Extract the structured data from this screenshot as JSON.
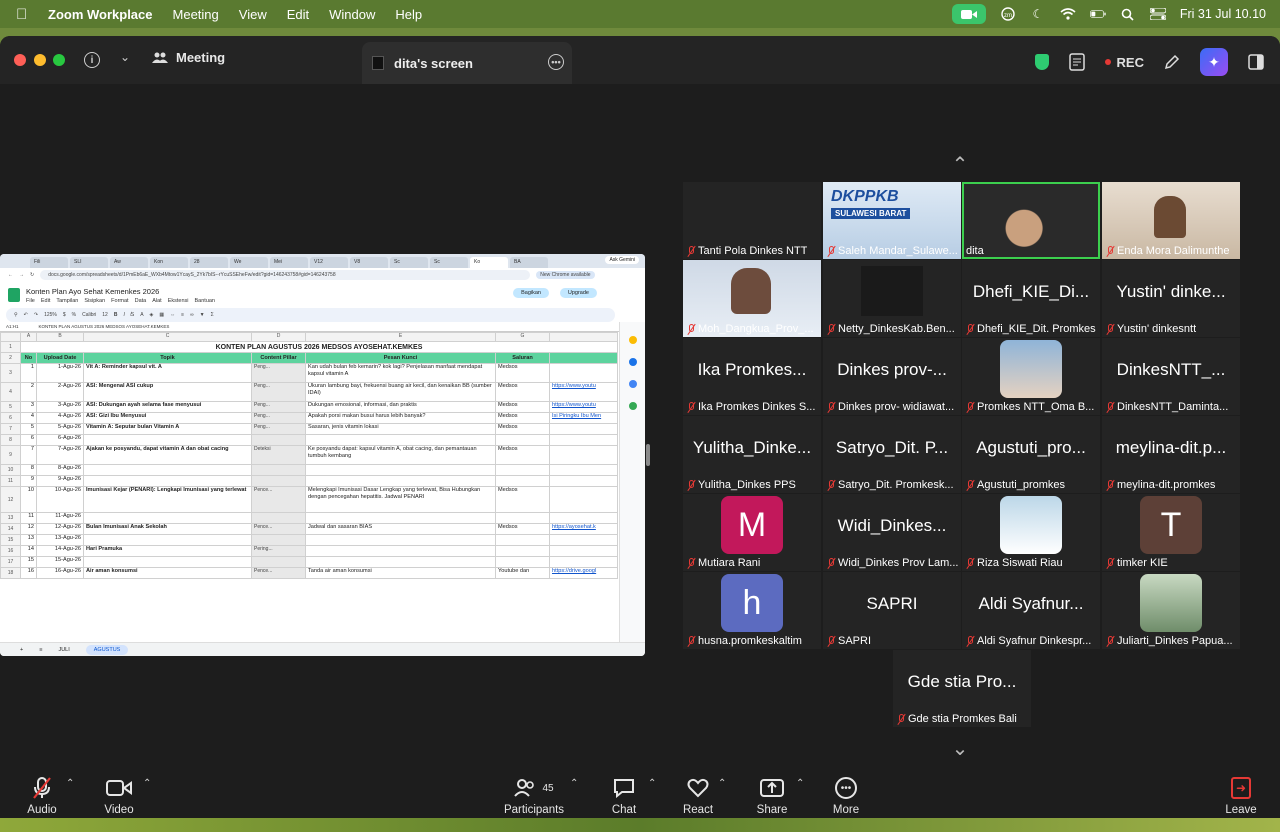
{
  "menubar": {
    "app": "Zoom Workplace",
    "items": [
      "Meeting",
      "View",
      "Edit",
      "Window",
      "Help"
    ],
    "datetime": "Fri 31 Jul  10.10"
  },
  "titlebar": {
    "meeting_label": "Meeting",
    "share_tab": "dita's screen",
    "rec_label": "REC"
  },
  "shared_screen": {
    "browser_tabs": [
      "Fili",
      "SLI",
      "Aw",
      "Kon",
      "28",
      "We",
      "Mei",
      "V12",
      "V8",
      "Sc",
      "Sc",
      "Ko",
      "BA"
    ],
    "ask_gemini": "Ask Gemini",
    "url": "docs.google.com/spreadsheets/d/1PmEb6aE_WXb4Mtow1YcayS_2Yk7bIS--rYcuSSEheFw/edit?gid=146243758#gid=146243758",
    "chrome_available": "New Chrome available",
    "doc_title": "Konten Plan Ayo Sehat Kemenkes 2026",
    "menus": [
      "File",
      "Edit",
      "Tampilan",
      "Sisipkan",
      "Format",
      "Data",
      "Alat",
      "Ekstensi",
      "Bantuan"
    ],
    "share_button": "Bagikan",
    "upgrade_button": "Upgrade",
    "zoom": "125%",
    "font": "Calibri",
    "font_size": "12",
    "cell_ref": "A1:H1",
    "formula": "KONTEN PLAN AGUSTUS 2026 MEDSOS AYOSEHAT.KEMKES",
    "col_letters": [
      "A",
      "B",
      "C",
      "D",
      "E",
      "G"
    ],
    "sheet_title": "KONTEN PLAN AGUSTUS 2026 MEDSOS AYOSEHAT.KEMKES",
    "headers": {
      "no": "No",
      "date": "Upload Date",
      "topic": "Topik",
      "pillar": "Content Pillar",
      "message": "Pesan Kunci",
      "channel": "Saluran"
    },
    "rows": [
      {
        "rn": "3",
        "no": "1",
        "date": "1-Agu-26",
        "topic": "Vit A: Reminder kapsul vit. A",
        "pillar": "Peng...",
        "msg": "Kan udah bulan feb kemarin? kok lagi? Penjelasan manfaat mendapat kapsul vitamin A",
        "ch": "Medsos",
        "link": ""
      },
      {
        "rn": "4",
        "no": "2",
        "date": "2-Agu-26",
        "topic": "ASI: Mengenal ASI cukup",
        "pillar": "Peng...",
        "msg": "Ukuran lambung bayi, frekuensi buang air kecil, dan kenaikan BB (sumber IDAI)",
        "ch": "Medsos",
        "link": "https://www.youtu"
      },
      {
        "rn": "5",
        "no": "3",
        "date": "3-Agu-26",
        "topic": "ASI: Dukungan ayah selama fase menyusui",
        "pillar": "Peng...",
        "msg": "Dukungan emosional, informasi, dan praktis",
        "ch": "Medsos",
        "link": "https://www.youtu"
      },
      {
        "rn": "6",
        "no": "4",
        "date": "4-Agu-26",
        "topic": "ASI: Gizi Ibu Menyusui",
        "pillar": "Peng...",
        "msg": "Apakah porsi makan busui harus lebih banyak?",
        "ch": "Medsos",
        "link": "Isi Piringku Ibu Men"
      },
      {
        "rn": "7",
        "no": "5",
        "date": "5-Agu-26",
        "topic": "Vitamin A: Seputar bulan Vitamin A",
        "pillar": "Peng...",
        "msg": "Sasaran, jenis vitamin lokasi",
        "ch": "Medsos",
        "link": ""
      },
      {
        "rn": "8",
        "no": "6",
        "date": "6-Agu-26",
        "topic": "",
        "pillar": "",
        "msg": "",
        "ch": "",
        "link": ""
      },
      {
        "rn": "9",
        "no": "7",
        "date": "7-Agu-26",
        "topic": "Ajakan ke posyandu, dapat vitamin A dan obat cacing",
        "pillar": "Deteksi",
        "msg": "Ke posyandu dapat: kapsul vitamin A, obat cacing, dan pemantauan tumbuh kembang",
        "ch": "Medsos",
        "link": ""
      },
      {
        "rn": "10",
        "no": "8",
        "date": "8-Agu-26",
        "topic": "",
        "pillar": "",
        "msg": "",
        "ch": "",
        "link": ""
      },
      {
        "rn": "11",
        "no": "9",
        "date": "9-Agu-26",
        "topic": "",
        "pillar": "",
        "msg": "",
        "ch": "",
        "link": ""
      },
      {
        "rn": "12",
        "no": "10",
        "date": "10-Agu-26",
        "topic": "Imunisasi Kejar (PENARI): Lengkapi Imunisasi yang terlewat",
        "pillar": "Pence...",
        "msg": "Melengkapi Imunisasi Dasar Lengkap yang terlewat, Bisa Hubungkan dengan pencegahan hepatitis. Jadwal PENARI",
        "ch": "Medsos",
        "link": ""
      },
      {
        "rn": "13",
        "no": "11",
        "date": "11-Agu-26",
        "topic": "",
        "pillar": "",
        "msg": "",
        "ch": "",
        "link": ""
      },
      {
        "rn": "14",
        "no": "12",
        "date": "12-Agu-26",
        "topic": "Bulan Imunisasi Anak Sekolah",
        "pillar": "Pence...",
        "msg": "Jadwal dan sasaran BIAS",
        "ch": "Medsos",
        "link": "https://ayosehat.k"
      },
      {
        "rn": "15",
        "no": "13",
        "date": "13-Agu-26",
        "topic": "",
        "pillar": "",
        "msg": "",
        "ch": "",
        "link": ""
      },
      {
        "rn": "16",
        "no": "14",
        "date": "14-Agu-26",
        "topic": "Hari Pramuka",
        "pillar": "Pering...",
        "msg": "",
        "ch": "",
        "link": ""
      },
      {
        "rn": "17",
        "no": "15",
        "date": "15-Agu-26",
        "topic": "",
        "pillar": "",
        "msg": "",
        "ch": "",
        "link": ""
      },
      {
        "rn": "18",
        "no": "16",
        "date": "16-Agu-26",
        "topic": "Air aman konsumsi",
        "pillar": "Pence...",
        "msg": "Tanda air aman konsumsi",
        "ch": "Youtube dan",
        "link": "https://drive.googl"
      }
    ],
    "sheet_tabs": [
      "JULI",
      "AGUSTUS"
    ]
  },
  "participants": [
    {
      "name": "Tanti Pola Dinkes NTT",
      "big": "",
      "avatar": "",
      "color": "",
      "kind": "dark"
    },
    {
      "name": "Saleh Mandar_Sulawe...",
      "big": "",
      "avatar": "",
      "color": "",
      "kind": "banner",
      "banner": "DKPPKB",
      "banner2": "SULAWESI BARAT"
    },
    {
      "name": "dita",
      "big": "",
      "avatar": "",
      "color": "",
      "kind": "video",
      "speaking": true
    },
    {
      "name": "Enda Mora Dalimunthe",
      "big": "",
      "avatar": "",
      "color": "",
      "kind": "room"
    },
    {
      "name": "Moh_Dangkua_Prov_...",
      "big": "",
      "avatar": "",
      "color": "",
      "kind": "cartoon"
    },
    {
      "name": "Netty_DinkesKab.Ben...",
      "big": "",
      "avatar": "",
      "color": "",
      "kind": "darkvid"
    },
    {
      "name": "Dhefi_KIE_Dit. Promkes",
      "big": "Dhefi_KIE_Di...",
      "avatar": "",
      "color": "",
      "kind": "name"
    },
    {
      "name": "Yustin' dinkesntt",
      "big": "Yustin' dinke...",
      "avatar": "",
      "color": "",
      "kind": "name"
    },
    {
      "name": "Ika Promkes Dinkes S...",
      "big": "Ika Promkes...",
      "avatar": "",
      "color": "",
      "kind": "name"
    },
    {
      "name": "Dinkes prov- widiawat...",
      "big": "Dinkes prov-...",
      "avatar": "",
      "color": "",
      "kind": "name"
    },
    {
      "name": "Promkes NTT_Oma B...",
      "big": "",
      "avatar": "",
      "color": "",
      "kind": "photo"
    },
    {
      "name": "DinkesNTT_Daminta...",
      "big": "DinkesNTT_...",
      "avatar": "",
      "color": "",
      "kind": "name"
    },
    {
      "name": "Yulitha_Dinkes PPS",
      "big": "Yulitha_Dinke...",
      "avatar": "",
      "color": "",
      "kind": "name"
    },
    {
      "name": "Satryo_Dit. Promkesk...",
      "big": "Satryo_Dit. P...",
      "avatar": "",
      "color": "",
      "kind": "name"
    },
    {
      "name": "Agustuti_promkes",
      "big": "Agustuti_pro...",
      "avatar": "",
      "color": "",
      "kind": "name"
    },
    {
      "name": "meylina-dit.promkes",
      "big": "meylina-dit.p...",
      "avatar": "",
      "color": "",
      "kind": "name"
    },
    {
      "name": "Mutiara Rani",
      "big": "",
      "avatar": "M",
      "color": "#c2185b",
      "kind": "letter"
    },
    {
      "name": "Widi_Dinkes Prov Lam...",
      "big": "Widi_Dinkes...",
      "avatar": "",
      "color": "",
      "kind": "name"
    },
    {
      "name": "Riza Siswati Riau",
      "big": "",
      "avatar": "",
      "color": "",
      "kind": "photo2"
    },
    {
      "name": "timker KIE",
      "big": "",
      "avatar": "T",
      "color": "#5d4037",
      "kind": "letter"
    },
    {
      "name": "husna.promkeskaltim",
      "big": "",
      "avatar": "h",
      "color": "#5c6bc0",
      "kind": "letter"
    },
    {
      "name": "SAPRI",
      "big": "SAPRI",
      "avatar": "",
      "color": "",
      "kind": "name"
    },
    {
      "name": "Aldi Syafnur Dinkespr...",
      "big": "Aldi Syafnur...",
      "avatar": "",
      "color": "",
      "kind": "name"
    },
    {
      "name": "Juliarti_Dinkes Papua...",
      "big": "",
      "avatar": "",
      "color": "",
      "kind": "photo3"
    },
    {
      "name": "Gde stia Promkes Bali",
      "big": "Gde stia Pro...",
      "avatar": "",
      "color": "",
      "kind": "name"
    }
  ],
  "toolbar": {
    "audio": "Audio",
    "video": "Video",
    "participants": "Participants",
    "participants_count": "45",
    "chat": "Chat",
    "react": "React",
    "share": "Share",
    "more": "More",
    "leave": "Leave"
  }
}
